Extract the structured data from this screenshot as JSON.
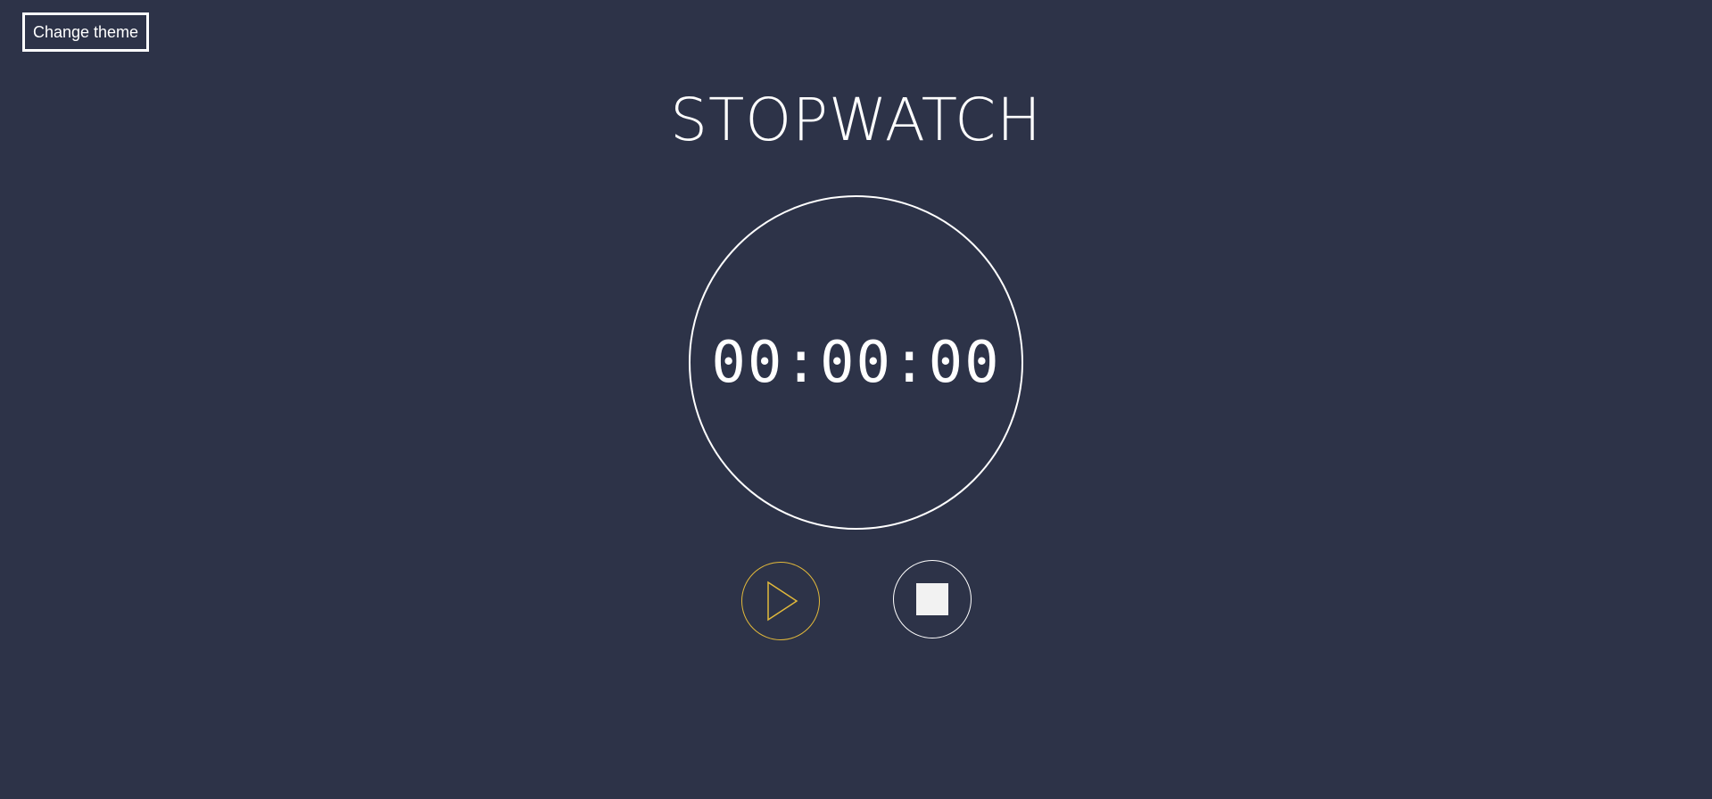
{
  "theme_button": {
    "label": "Change theme"
  },
  "header": {
    "title": "STOPWATCH"
  },
  "timer": {
    "display": "00:00:00"
  },
  "controls": {
    "play": {
      "icon": "play-icon",
      "color": "#e2b93b"
    },
    "stop": {
      "icon": "stop-icon",
      "color": "#ffffff"
    }
  },
  "colors": {
    "background": "#2d3348",
    "foreground": "#ffffff",
    "accent": "#e2b93b"
  }
}
